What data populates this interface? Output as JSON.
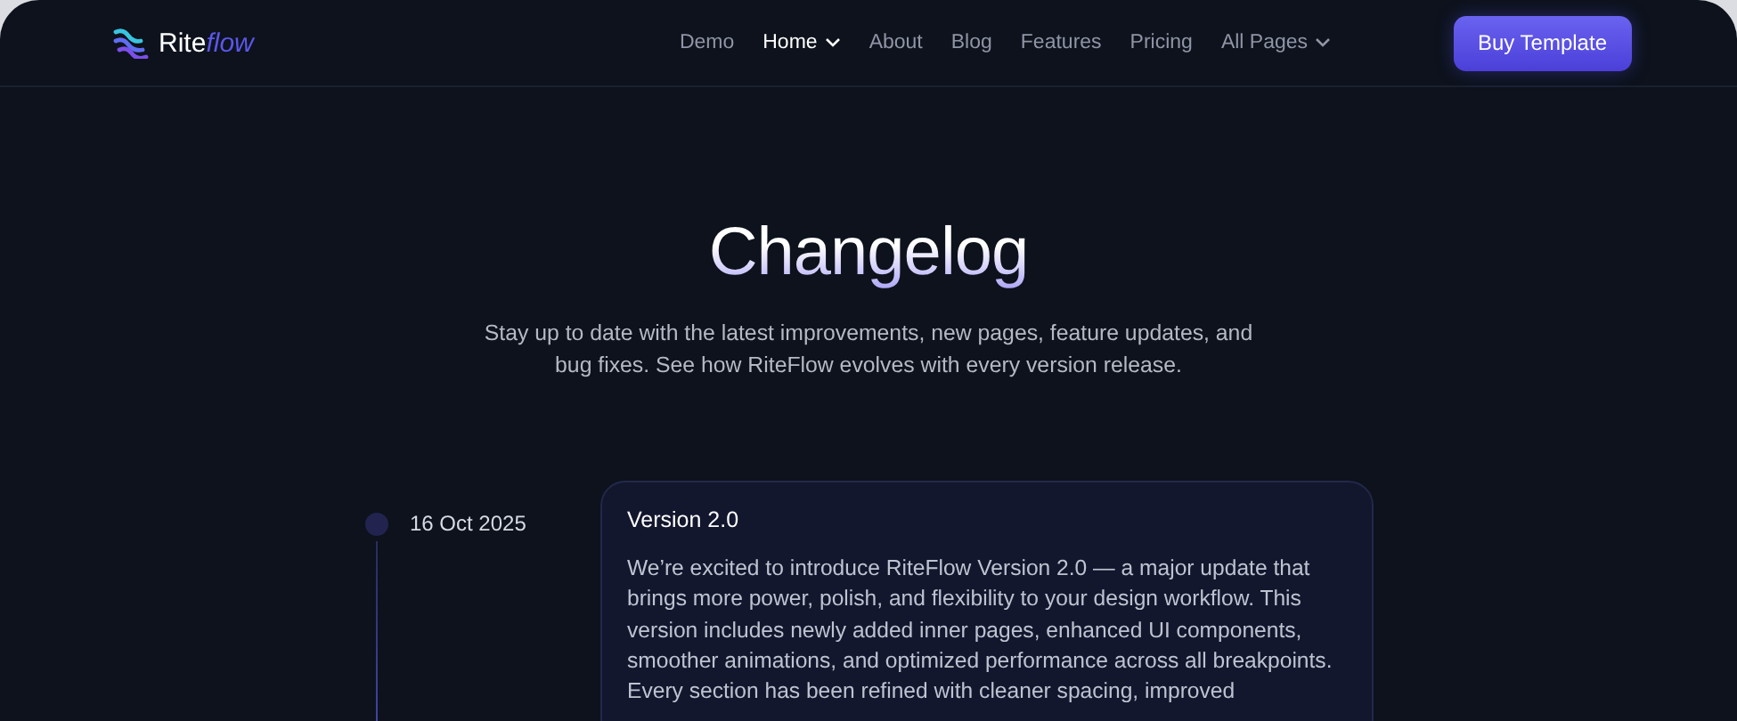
{
  "header": {
    "logo": {
      "primary": "Rite",
      "accent": "flow"
    },
    "nav": [
      {
        "label": "Demo",
        "selected": false,
        "dropdown": false
      },
      {
        "label": "Home",
        "selected": true,
        "dropdown": true
      },
      {
        "label": "About",
        "selected": false,
        "dropdown": false
      },
      {
        "label": "Blog",
        "selected": false,
        "dropdown": false
      },
      {
        "label": "Features",
        "selected": false,
        "dropdown": false
      },
      {
        "label": "Pricing",
        "selected": false,
        "dropdown": false
      },
      {
        "label": "All Pages",
        "selected": false,
        "dropdown": true
      }
    ],
    "cta": "Buy Template"
  },
  "hero": {
    "title": "Changelog",
    "subtitle": "Stay up to date with the latest improvements, new pages, feature updates, and bug fixes. See how RiteFlow evolves with every version release."
  },
  "entries": [
    {
      "date": "16 Oct 2025",
      "title": "Version 2.0",
      "body": "We’re excited to introduce RiteFlow Version 2.0 — a major update that brings more power, polish, and flexibility to your design workflow. This version includes newly added inner pages, enhanced UI components, smoother animations, and optimized performance across all breakpoints. Every section has been refined with cleaner spacing, improved"
    }
  ]
}
